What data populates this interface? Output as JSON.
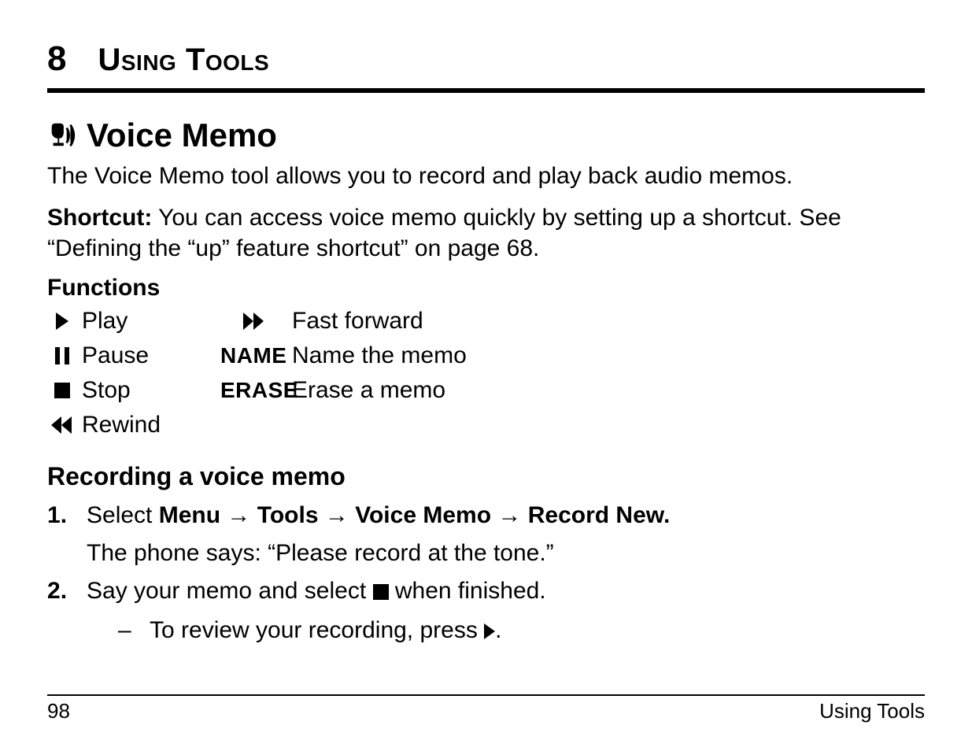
{
  "chapter": {
    "number": "8",
    "title": "Using Tools"
  },
  "section": {
    "title": "Voice Memo"
  },
  "intro": "The Voice Memo tool allows you to record and play back audio memos.",
  "shortcut": {
    "label": "Shortcut:",
    "text": " You can access voice memo quickly by setting up a shortcut. See “Defining the “up” feature shortcut” on page 68."
  },
  "functions": {
    "heading": "Functions",
    "items": {
      "play": "Play",
      "fastforward": "Fast forward",
      "pause": "Pause",
      "name_label": "NAME",
      "name_desc": "Name the memo",
      "stop": "Stop",
      "erase_label": "ERASE",
      "erase_desc": "Erase a memo",
      "rewind": "Rewind"
    }
  },
  "recording": {
    "heading": "Recording a voice memo",
    "step1_prefix": "Select ",
    "menu_path": [
      "Menu",
      "Tools",
      "Voice Memo",
      "Record New."
    ],
    "step1_sub": "The phone says: “Please record at the tone.”",
    "step2_a": "Say your memo and select ",
    "step2_b": " when finished.",
    "step2_sub_a": "To review your recording, press ",
    "step2_sub_b": "."
  },
  "footer": {
    "page": "98",
    "section": "Using Tools"
  }
}
